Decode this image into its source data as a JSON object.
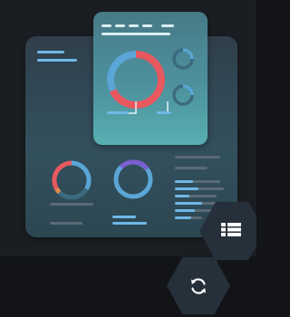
{
  "colors": {
    "page_background": "#121417",
    "backdrop": "#1a1d21",
    "panel": "#31464f",
    "card": "#4f95a0",
    "hexagon": "#26303b",
    "accent_blue": "#6fb8e6",
    "accent_red": "#e8595f",
    "accent_orange": "#e58a4f",
    "accent_purple": "#7a5fd0",
    "placeholder_bar": "#5a6a74",
    "icon": "#ffffff"
  },
  "icons": {
    "table_button": "list-table-icon",
    "refresh_button": "refresh-icon"
  },
  "charts": {
    "main_donut": {
      "red_fraction": 0.62,
      "blue_fraction": 0.38
    },
    "small_donut_1": {
      "fraction": 0.25
    },
    "small_donut_2": {
      "fraction": 0.25
    },
    "panel_donut_left": {
      "red_fraction": 0.45,
      "orange_fraction": 0.1,
      "blue_fraction": 0.45
    },
    "panel_donut_right": {
      "purple_fraction": 0.3,
      "blue_fraction": 0.7
    }
  },
  "bar_rows": [
    0.55,
    0.4,
    0.65,
    0.35,
    0.5,
    0.6
  ]
}
